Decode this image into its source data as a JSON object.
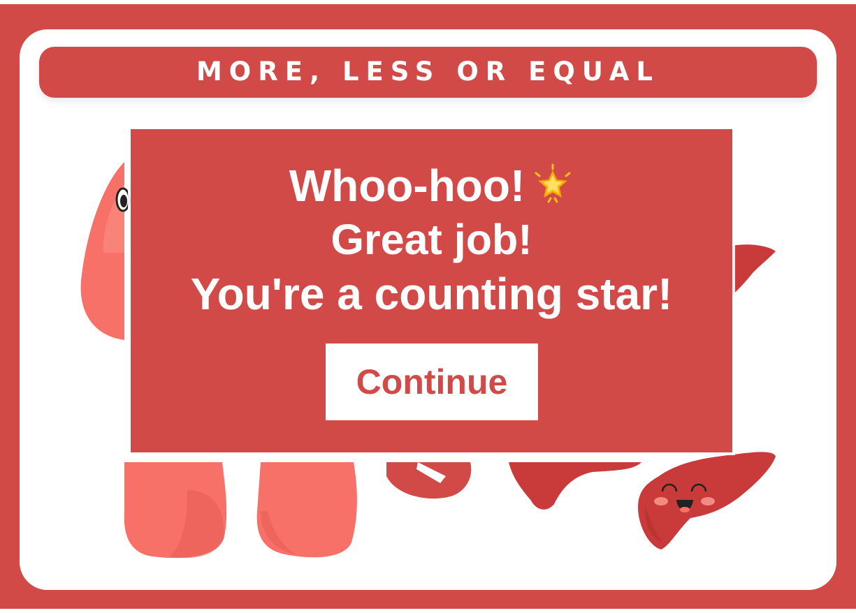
{
  "game": {
    "title": "MORE, LESS OR EQUAL"
  },
  "modal": {
    "line1": "Whoo-hoo!",
    "line2": "Great job!",
    "line3": "You're a counting star!",
    "continue_label": "Continue"
  },
  "icons": {
    "celebration": "glowing-star-icon"
  },
  "colors": {
    "brand_red": "#d24a48",
    "board_white": "#ffffff",
    "lung_salmon": "#f77168",
    "liver_red": "#c93b3b"
  }
}
